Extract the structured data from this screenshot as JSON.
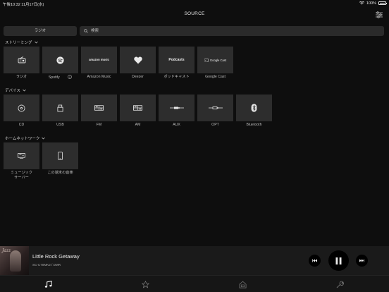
{
  "status_bar": {
    "time": "午後10:32",
    "date": "11月17日(水)",
    "battery": "100%"
  },
  "header": {
    "title": "SOURCE"
  },
  "radio_button": {
    "label": "ラジオ"
  },
  "search": {
    "placeholder": "検索"
  },
  "sections": {
    "streaming": {
      "title": "ストリーミング",
      "items": [
        {
          "label": "ラジオ",
          "icon": "radio-icon"
        },
        {
          "label": "Spotify",
          "icon": "spotify-icon"
        },
        {
          "label": "Amazon Music",
          "icon": "amazon-music-logo",
          "logo_text": "amazon music"
        },
        {
          "label": "Deezer",
          "icon": "deezer-heart-icon"
        },
        {
          "label": "ポッドキャスト",
          "icon": "podcasts-logo",
          "logo_text": "Podcasts"
        },
        {
          "label": "Google Cast",
          "icon": "google-cast-logo",
          "logo_text": "Google Cast"
        }
      ]
    },
    "devices": {
      "title": "デバイス",
      "items": [
        {
          "label": "CD",
          "icon": "disc-icon"
        },
        {
          "label": "USB",
          "icon": "usb-icon"
        },
        {
          "label": "FM",
          "icon": "tuner-icon"
        },
        {
          "label": "AM",
          "icon": "tuner-icon"
        },
        {
          "label": "AUX",
          "icon": "cable-icon"
        },
        {
          "label": "OPT",
          "icon": "optical-cable-icon"
        },
        {
          "label": "Bluetooth",
          "icon": "bluetooth-icon"
        }
      ]
    },
    "home_network": {
      "title": "ホームネットワーク",
      "items": [
        {
          "label": "ミュージック サーバー",
          "label_line1": "ミュージック",
          "label_line2": "サーバー",
          "icon": "media-server-icon"
        },
        {
          "label": "この端末の音楽",
          "icon": "phone-icon"
        }
      ]
    }
  },
  "player": {
    "album_art_text": "Jazz",
    "song_title": "Little Rock Getaway",
    "device": "SC-C70MK2 / DMR"
  },
  "tabs": [
    {
      "name": "music",
      "icon": "music-note-icon",
      "active": true
    },
    {
      "name": "favorites",
      "icon": "star-icon",
      "active": false
    },
    {
      "name": "home",
      "icon": "home-icon",
      "active": false
    },
    {
      "name": "tools",
      "icon": "wrench-icon",
      "active": false
    }
  ],
  "colors": {
    "background": "#0e0e0e",
    "tile": "#2d2d2d",
    "player_bar": "#1a1a1a",
    "accent": "#ffffff"
  }
}
